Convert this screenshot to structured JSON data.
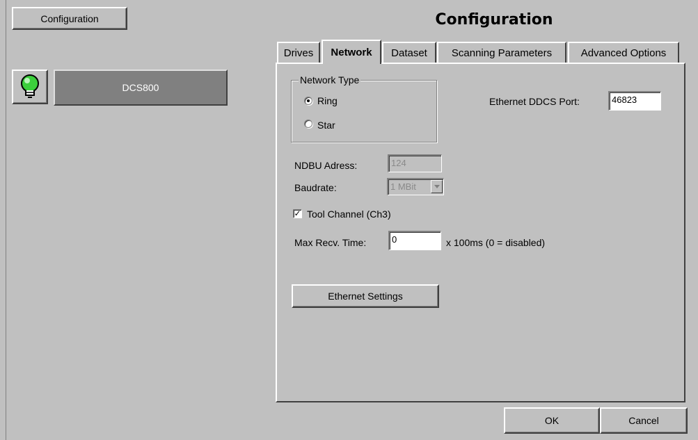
{
  "header": {
    "config_button_label": "Configuration",
    "page_title": "Configuration"
  },
  "device": {
    "icon": "lightbulb-icon",
    "status_color": "#3ccf3c",
    "name": "DCS800"
  },
  "tabs": [
    {
      "label": "Drives",
      "active": false
    },
    {
      "label": "Network",
      "active": true
    },
    {
      "label": "Dataset",
      "active": false
    },
    {
      "label": "Scanning Parameters",
      "active": false
    },
    {
      "label": "Advanced Options",
      "active": false
    }
  ],
  "network": {
    "network_type_label": "Network Type",
    "options": [
      {
        "label": "Ring",
        "selected": true
      },
      {
        "label": "Star",
        "selected": false
      }
    ],
    "ethernet_ddcs_port_label": "Ethernet DDCS Port:",
    "ethernet_ddcs_port_value": "46823",
    "ndbu_address_label": "NDBU Adress:",
    "ndbu_address_value": "124",
    "baudrate_label": "Baudrate:",
    "baudrate_value": "1 MBit",
    "tool_channel_label": "Tool Channel (Ch3)",
    "tool_channel_checked": true,
    "max_recv_time_label": "Max Recv. Time:",
    "max_recv_time_value": "0",
    "max_recv_time_unit": "x 100ms (0 = disabled)",
    "ethernet_settings_button": "Ethernet Settings"
  },
  "footer": {
    "ok_label": "OK",
    "cancel_label": "Cancel"
  }
}
